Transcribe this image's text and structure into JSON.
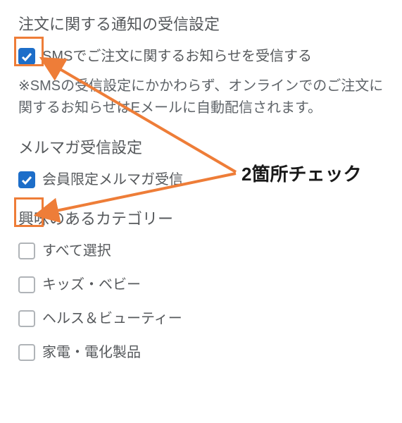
{
  "section1": {
    "title": "注文に関する通知の受信設定",
    "checkbox": {
      "label": "SMSでご注文に関するお知らせを受信する",
      "checked": true
    },
    "note": "※SMSの受信設定にかかわらず、オンラインでのご注文に関するお知らせはEメールに自動配信されます。"
  },
  "section2": {
    "title": "メルマガ受信設定",
    "checkbox": {
      "label": "会員限定メルマガ受信",
      "checked": true
    }
  },
  "section3": {
    "title": "興味のあるカテゴリー",
    "items": [
      {
        "label": "すべて選択",
        "checked": false
      },
      {
        "label": "キッズ・ベビー",
        "checked": false
      },
      {
        "label": "ヘルス＆ビューティー",
        "checked": false
      },
      {
        "label": "家電・電化製品",
        "checked": false
      }
    ]
  },
  "annotation": "2箇所チェック",
  "colors": {
    "accent": "#1d6ec9",
    "highlight": "#ee7d38"
  }
}
